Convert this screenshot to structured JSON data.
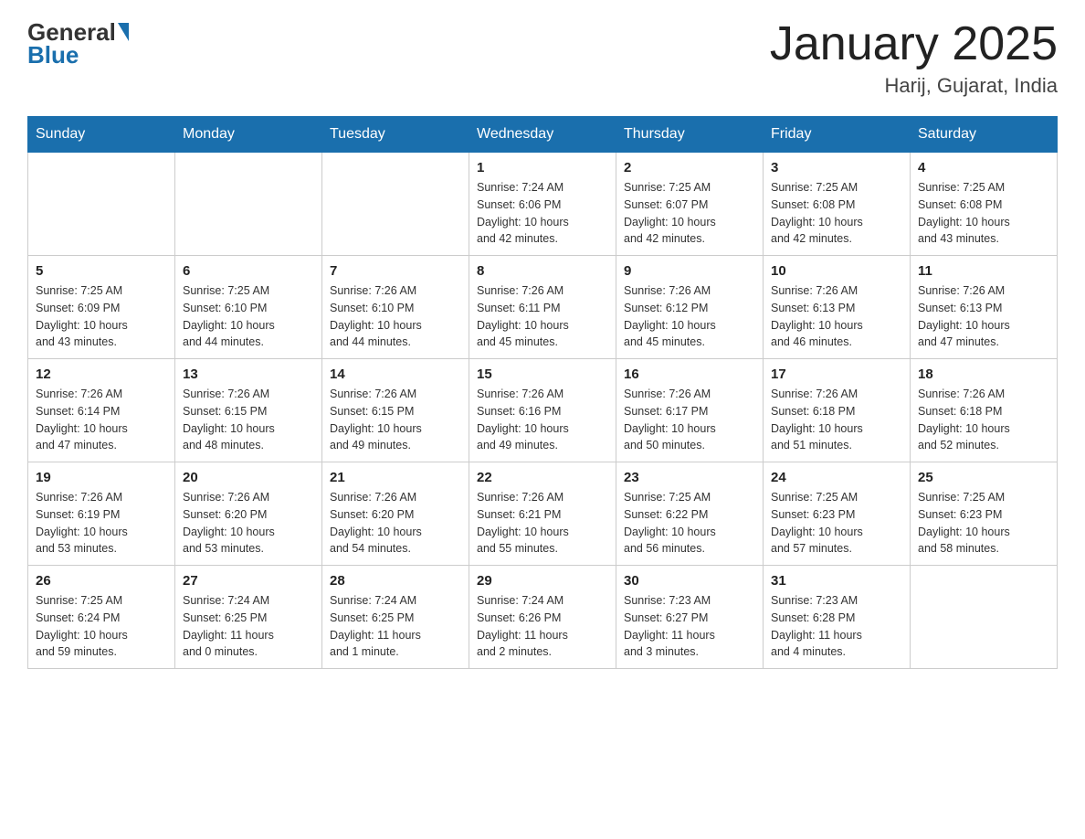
{
  "header": {
    "logo_general": "General",
    "logo_blue": "Blue",
    "title": "January 2025",
    "subtitle": "Harij, Gujarat, India"
  },
  "calendar": {
    "days_of_week": [
      "Sunday",
      "Monday",
      "Tuesday",
      "Wednesday",
      "Thursday",
      "Friday",
      "Saturday"
    ],
    "weeks": [
      [
        {
          "day": "",
          "info": ""
        },
        {
          "day": "",
          "info": ""
        },
        {
          "day": "",
          "info": ""
        },
        {
          "day": "1",
          "info": "Sunrise: 7:24 AM\nSunset: 6:06 PM\nDaylight: 10 hours\nand 42 minutes."
        },
        {
          "day": "2",
          "info": "Sunrise: 7:25 AM\nSunset: 6:07 PM\nDaylight: 10 hours\nand 42 minutes."
        },
        {
          "day": "3",
          "info": "Sunrise: 7:25 AM\nSunset: 6:08 PM\nDaylight: 10 hours\nand 42 minutes."
        },
        {
          "day": "4",
          "info": "Sunrise: 7:25 AM\nSunset: 6:08 PM\nDaylight: 10 hours\nand 43 minutes."
        }
      ],
      [
        {
          "day": "5",
          "info": "Sunrise: 7:25 AM\nSunset: 6:09 PM\nDaylight: 10 hours\nand 43 minutes."
        },
        {
          "day": "6",
          "info": "Sunrise: 7:25 AM\nSunset: 6:10 PM\nDaylight: 10 hours\nand 44 minutes."
        },
        {
          "day": "7",
          "info": "Sunrise: 7:26 AM\nSunset: 6:10 PM\nDaylight: 10 hours\nand 44 minutes."
        },
        {
          "day": "8",
          "info": "Sunrise: 7:26 AM\nSunset: 6:11 PM\nDaylight: 10 hours\nand 45 minutes."
        },
        {
          "day": "9",
          "info": "Sunrise: 7:26 AM\nSunset: 6:12 PM\nDaylight: 10 hours\nand 45 minutes."
        },
        {
          "day": "10",
          "info": "Sunrise: 7:26 AM\nSunset: 6:13 PM\nDaylight: 10 hours\nand 46 minutes."
        },
        {
          "day": "11",
          "info": "Sunrise: 7:26 AM\nSunset: 6:13 PM\nDaylight: 10 hours\nand 47 minutes."
        }
      ],
      [
        {
          "day": "12",
          "info": "Sunrise: 7:26 AM\nSunset: 6:14 PM\nDaylight: 10 hours\nand 47 minutes."
        },
        {
          "day": "13",
          "info": "Sunrise: 7:26 AM\nSunset: 6:15 PM\nDaylight: 10 hours\nand 48 minutes."
        },
        {
          "day": "14",
          "info": "Sunrise: 7:26 AM\nSunset: 6:15 PM\nDaylight: 10 hours\nand 49 minutes."
        },
        {
          "day": "15",
          "info": "Sunrise: 7:26 AM\nSunset: 6:16 PM\nDaylight: 10 hours\nand 49 minutes."
        },
        {
          "day": "16",
          "info": "Sunrise: 7:26 AM\nSunset: 6:17 PM\nDaylight: 10 hours\nand 50 minutes."
        },
        {
          "day": "17",
          "info": "Sunrise: 7:26 AM\nSunset: 6:18 PM\nDaylight: 10 hours\nand 51 minutes."
        },
        {
          "day": "18",
          "info": "Sunrise: 7:26 AM\nSunset: 6:18 PM\nDaylight: 10 hours\nand 52 minutes."
        }
      ],
      [
        {
          "day": "19",
          "info": "Sunrise: 7:26 AM\nSunset: 6:19 PM\nDaylight: 10 hours\nand 53 minutes."
        },
        {
          "day": "20",
          "info": "Sunrise: 7:26 AM\nSunset: 6:20 PM\nDaylight: 10 hours\nand 53 minutes."
        },
        {
          "day": "21",
          "info": "Sunrise: 7:26 AM\nSunset: 6:20 PM\nDaylight: 10 hours\nand 54 minutes."
        },
        {
          "day": "22",
          "info": "Sunrise: 7:26 AM\nSunset: 6:21 PM\nDaylight: 10 hours\nand 55 minutes."
        },
        {
          "day": "23",
          "info": "Sunrise: 7:25 AM\nSunset: 6:22 PM\nDaylight: 10 hours\nand 56 minutes."
        },
        {
          "day": "24",
          "info": "Sunrise: 7:25 AM\nSunset: 6:23 PM\nDaylight: 10 hours\nand 57 minutes."
        },
        {
          "day": "25",
          "info": "Sunrise: 7:25 AM\nSunset: 6:23 PM\nDaylight: 10 hours\nand 58 minutes."
        }
      ],
      [
        {
          "day": "26",
          "info": "Sunrise: 7:25 AM\nSunset: 6:24 PM\nDaylight: 10 hours\nand 59 minutes."
        },
        {
          "day": "27",
          "info": "Sunrise: 7:24 AM\nSunset: 6:25 PM\nDaylight: 11 hours\nand 0 minutes."
        },
        {
          "day": "28",
          "info": "Sunrise: 7:24 AM\nSunset: 6:25 PM\nDaylight: 11 hours\nand 1 minute."
        },
        {
          "day": "29",
          "info": "Sunrise: 7:24 AM\nSunset: 6:26 PM\nDaylight: 11 hours\nand 2 minutes."
        },
        {
          "day": "30",
          "info": "Sunrise: 7:23 AM\nSunset: 6:27 PM\nDaylight: 11 hours\nand 3 minutes."
        },
        {
          "day": "31",
          "info": "Sunrise: 7:23 AM\nSunset: 6:28 PM\nDaylight: 11 hours\nand 4 minutes."
        },
        {
          "day": "",
          "info": ""
        }
      ]
    ]
  }
}
